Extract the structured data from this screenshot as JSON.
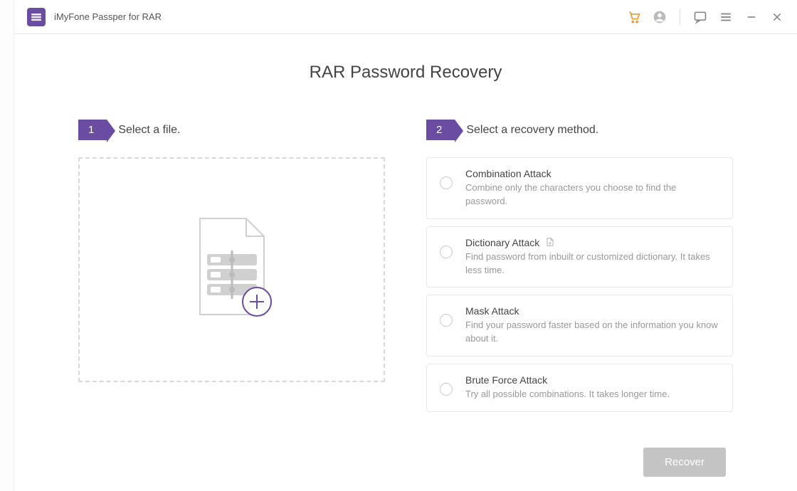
{
  "app": {
    "title": "iMyFone Passper for RAR"
  },
  "page": {
    "title": "RAR Password Recovery"
  },
  "step1": {
    "badge": "1",
    "label": "Select a file."
  },
  "step2": {
    "badge": "2",
    "label": "Select a recovery method."
  },
  "methods": [
    {
      "title": "Combination Attack",
      "desc": "Combine only the characters you choose to find the password.",
      "hasFileIcon": false
    },
    {
      "title": "Dictionary Attack",
      "desc": "Find password from inbuilt or customized dictionary. It takes less time.",
      "hasFileIcon": true
    },
    {
      "title": "Mask Attack",
      "desc": "Find your password faster based on the information you know about it.",
      "hasFileIcon": false
    },
    {
      "title": "Brute Force Attack",
      "desc": "Try all possible combinations. It takes longer time.",
      "hasFileIcon": false
    }
  ],
  "recover": {
    "label": "Recover"
  }
}
